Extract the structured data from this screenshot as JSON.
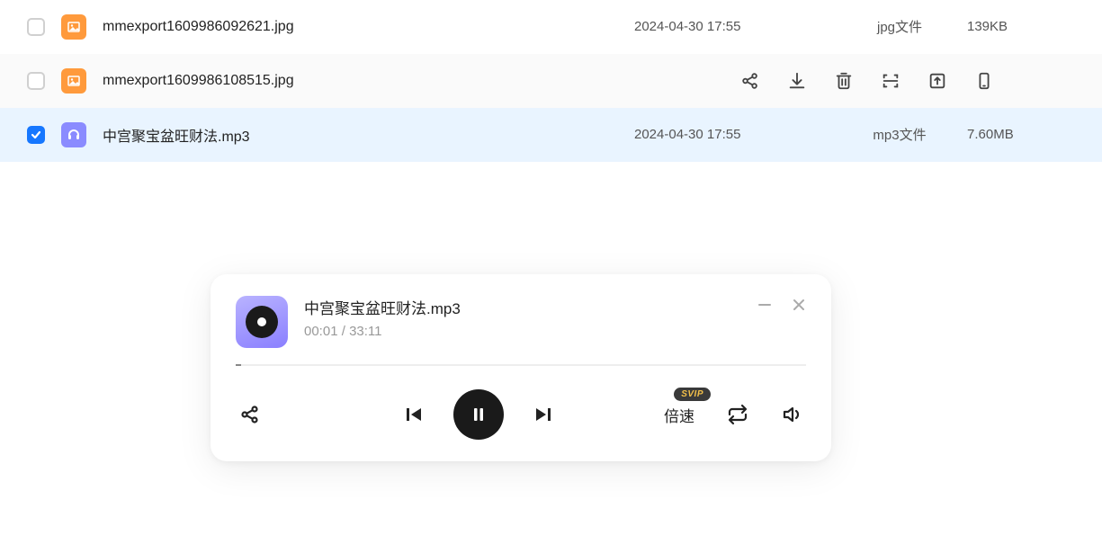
{
  "files": [
    {
      "name": "mmexport1609986092621.jpg",
      "date": "2024-04-30 17:55",
      "type": "jpg文件",
      "size": "139KB",
      "icon": "image",
      "selected": false,
      "hovered": false,
      "showActions": false
    },
    {
      "name": "mmexport1609986108515.jpg",
      "date": "",
      "type": "",
      "size": "",
      "icon": "image",
      "selected": false,
      "hovered": true,
      "showActions": true
    },
    {
      "name": "中宫聚宝盆旺财法.mp3",
      "date": "2024-04-30 17:55",
      "type": "mp3文件",
      "size": "7.60MB",
      "icon": "audio",
      "selected": true,
      "hovered": false,
      "showActions": false
    }
  ],
  "rowActions": [
    "share",
    "download",
    "delete",
    "scan",
    "move",
    "mobile"
  ],
  "player": {
    "title": "中宫聚宝盆旺财法.mp3",
    "currentTime": "00:01",
    "separator": " / ",
    "totalTime": "33:11",
    "speed_label": "倍速",
    "svip_badge": "SVIP"
  }
}
